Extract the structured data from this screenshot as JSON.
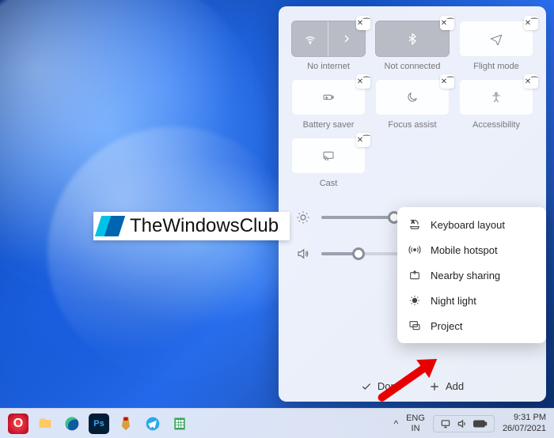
{
  "panel": {
    "tiles": [
      {
        "label": "No internet",
        "icon": "wifi",
        "split": true
      },
      {
        "label": "Not connected",
        "icon": "bluetooth",
        "gray": true
      },
      {
        "label": "Flight mode",
        "icon": "plane"
      },
      {
        "label": "Battery saver",
        "icon": "battery"
      },
      {
        "label": "Focus assist",
        "icon": "moon"
      },
      {
        "label": "Accessibility",
        "icon": "accessibility"
      },
      {
        "label": "Cast",
        "icon": "cast"
      }
    ],
    "brightness_pct": 35,
    "volume_pct": 20,
    "done_label": "Done",
    "add_label": "Add"
  },
  "popup": {
    "items": [
      {
        "label": "Keyboard layout",
        "icon": "keyboard"
      },
      {
        "label": "Mobile hotspot",
        "icon": "hotspot"
      },
      {
        "label": "Nearby sharing",
        "icon": "share"
      },
      {
        "label": "Night light",
        "icon": "nightlight"
      },
      {
        "label": "Project",
        "icon": "project"
      }
    ]
  },
  "watermark": {
    "text": "TheWindowsClub"
  },
  "taskbar": {
    "lang1": "ENG",
    "lang2": "IN",
    "time": "9:31 PM",
    "date": "26/07/2021",
    "chevron": "^"
  }
}
